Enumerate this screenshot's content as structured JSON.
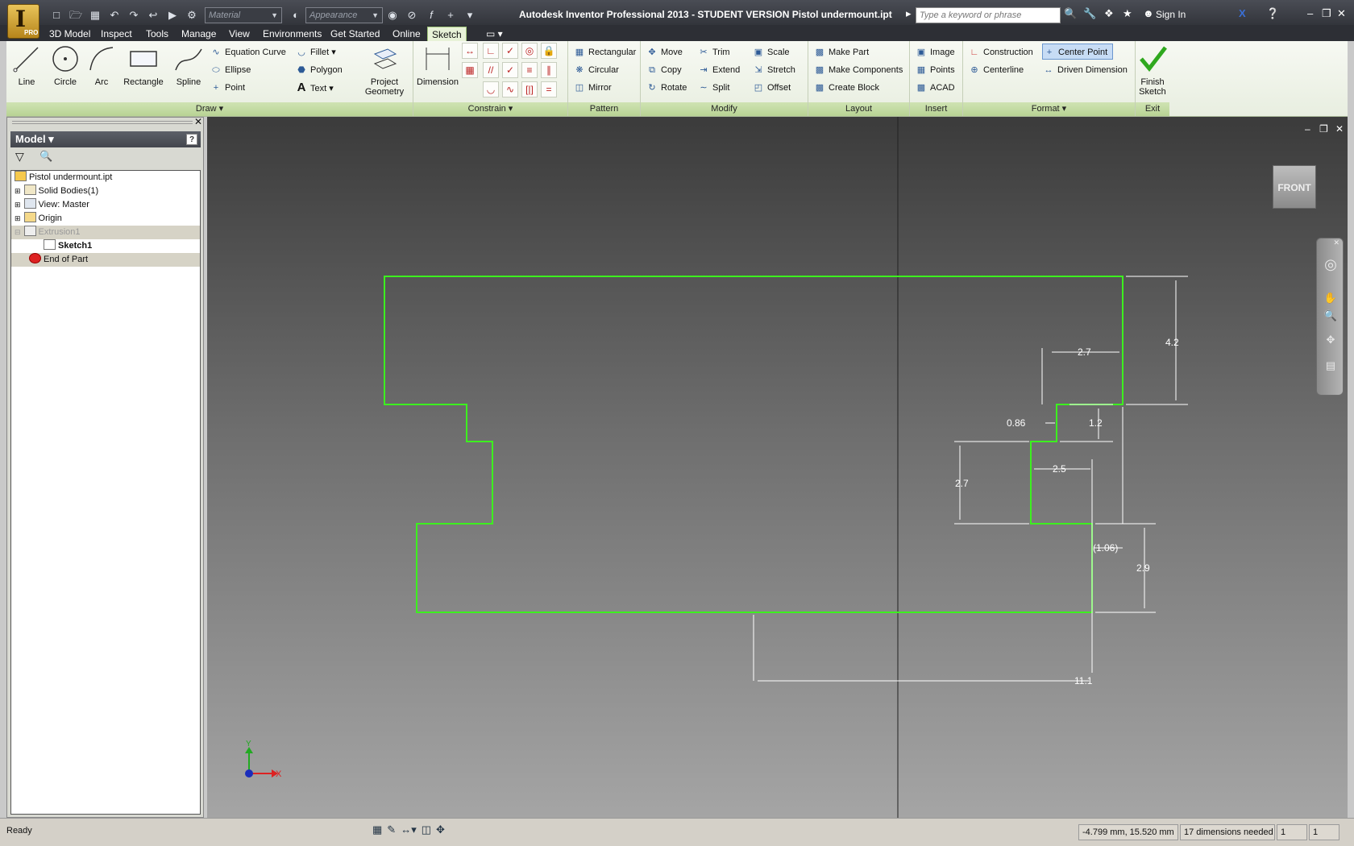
{
  "app": {
    "title": "Autodesk Inventor Professional 2013 - STUDENT VERSION   Pistol undermount.ipt",
    "badge": "PRO",
    "logo_letter": "I",
    "material_placeholder": "Material",
    "appearance_placeholder": "Appearance",
    "search_placeholder": "Type a keyword or phrase",
    "sign_in": "Sign In"
  },
  "menu_tabs": [
    "3D Model",
    "Inspect",
    "Tools",
    "Manage",
    "View",
    "Environments",
    "Get Started",
    "Online",
    "Sketch"
  ],
  "active_tab": "Sketch",
  "ribbon": {
    "draw": {
      "title": "Draw",
      "big": [
        "Line",
        "Circle",
        "Arc",
        "Rectangle",
        "Spline"
      ],
      "small": [
        "Equation Curve",
        "Ellipse",
        "Point",
        "Fillet",
        "Polygon",
        "Text"
      ],
      "project_geometry": [
        "Project",
        "Geometry"
      ]
    },
    "constrain": {
      "title": "Constrain",
      "dimension": "Dimension"
    },
    "pattern": {
      "title": "Pattern",
      "items": [
        "Rectangular",
        "Circular",
        "Mirror"
      ]
    },
    "modify": {
      "title": "Modify",
      "items": [
        "Move",
        "Copy",
        "Rotate",
        "Trim",
        "Extend",
        "Split",
        "Scale",
        "Stretch",
        "Offset"
      ]
    },
    "layout": {
      "title": "Layout",
      "items": [
        "Make Part",
        "Make Components",
        "Create Block"
      ]
    },
    "insert": {
      "title": "Insert",
      "items": [
        "Image",
        "Points",
        "ACAD"
      ]
    },
    "format": {
      "title": "Format",
      "items": [
        "Construction",
        "Centerline",
        "Center Point",
        "Driven Dimension"
      ]
    },
    "exit": {
      "title": "Exit",
      "finish": [
        "Finish",
        "Sketch"
      ]
    }
  },
  "browser": {
    "title": "Model",
    "help": "?",
    "tree": [
      "Pistol undermount.ipt",
      "Solid Bodies(1)",
      "View: Master",
      "Origin",
      "Extrusion1",
      "Sketch1",
      "End of Part"
    ]
  },
  "viewport": {
    "viewcube": "FRONT",
    "axis_x": "X",
    "axis_y": "Y",
    "dimensions": [
      "4.2",
      "2.7",
      "1.2",
      "0.86",
      "2.7",
      "2.5",
      "(1.06)",
      "2.9",
      "11.1"
    ]
  },
  "status": {
    "ready": "Ready",
    "coords": "-4.799 mm, 15.520 mm",
    "dims_needed": "17 dimensions needed",
    "count1": "1",
    "count2": "1"
  },
  "colors": {
    "sketch_line": "#3cf01e",
    "ribbon_green": "#b8d394",
    "titlebar": "#2d2f35"
  }
}
